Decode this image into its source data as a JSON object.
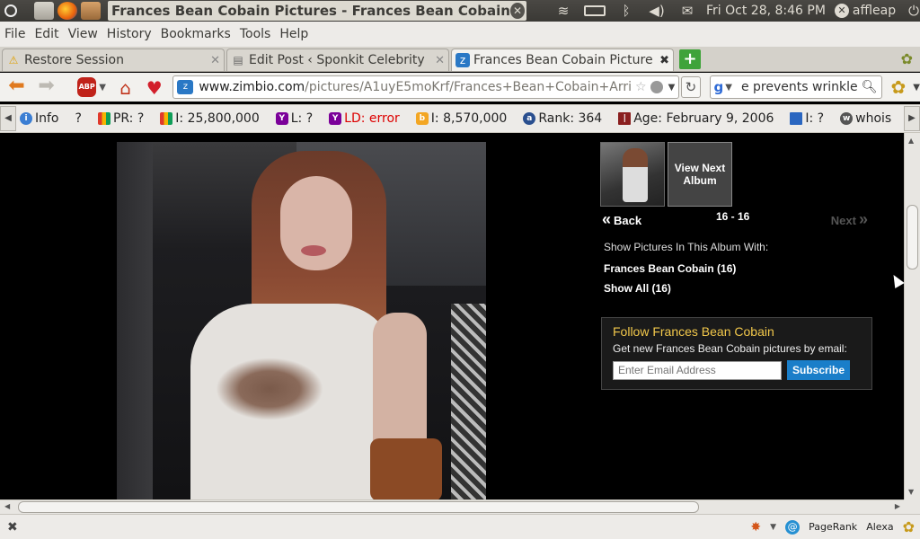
{
  "top_panel": {
    "window_title": "Frances Bean Cobain Pictures - Frances Bean Cobain Arri...",
    "clock": "Fri Oct 28,  8:46 PM",
    "user": "affleap"
  },
  "menubar": [
    "File",
    "Edit",
    "View",
    "History",
    "Bookmarks",
    "Tools",
    "Help"
  ],
  "tabs": [
    {
      "label": "Restore Session",
      "icon": "warning-icon"
    },
    {
      "label": "Edit Post ‹ Sponkit Celebrity ...",
      "icon": "page-icon"
    },
    {
      "label": "Frances Bean Cobain Picture...",
      "icon": "zimbio-icon"
    }
  ],
  "navbar": {
    "url_host": "www.zimbio.com",
    "url_path": "/pictures/A1uyE5moKrf/Frances+Bean+Cobain+Arri",
    "search_text": "e prevents wrinkles?",
    "abp_label": "ABP"
  },
  "seo_items": [
    {
      "icon": "info-icon",
      "text": "Info"
    },
    {
      "icon": "question-icon",
      "text": "?"
    },
    {
      "icon": "google-pr-icon",
      "text": "PR: ?"
    },
    {
      "icon": "google-index-icon",
      "text": "I: 25,800,000"
    },
    {
      "icon": "yahoo-links-icon",
      "text": "L: ?"
    },
    {
      "icon": "yahoo-ld-icon",
      "text": "LD: error",
      "error": true
    },
    {
      "icon": "bing-index-icon",
      "text": "I: 8,570,000"
    },
    {
      "icon": "alexa-rank-icon",
      "text": "Rank: 364"
    },
    {
      "icon": "archive-age-icon",
      "text": "Age: February 9, 2006"
    },
    {
      "icon": "dmoz-icon",
      "text": "I: ?"
    },
    {
      "icon": "whois-icon",
      "text": "whois"
    }
  ],
  "sidebar": {
    "next_album": "View Next Album",
    "back": "Back",
    "count": "16 - 16",
    "next": "Next",
    "show_label": "Show Pictures In This Album With:",
    "links": [
      "Frances Bean Cobain (16)",
      "Show All (16)"
    ],
    "follow": {
      "title": "Follow Frances Bean Cobain",
      "subtitle": "Get new Frances Bean Cobain pictures by email:",
      "placeholder": "Enter Email Address",
      "button": "Subscribe"
    }
  },
  "statusbar": {
    "pagerank": "PageRank",
    "alexa": "Alexa"
  }
}
